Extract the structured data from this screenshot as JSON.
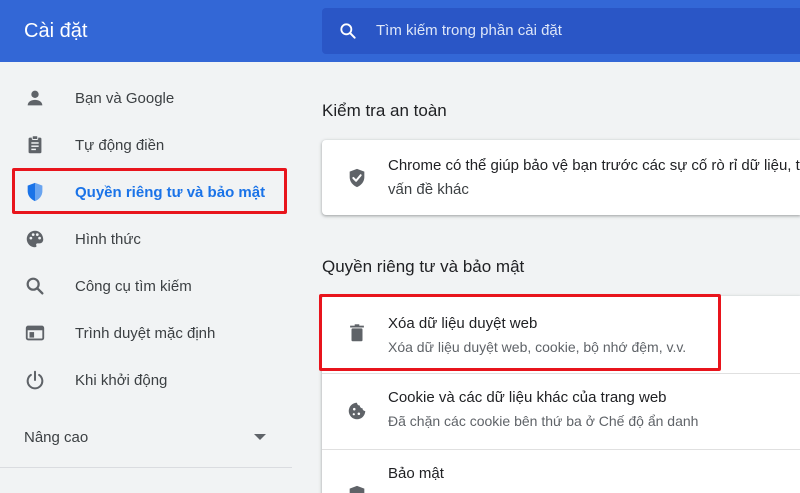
{
  "header": {
    "title": "Cài đặt",
    "search_placeholder": "Tìm kiếm trong phần cài đặt"
  },
  "sidebar": {
    "items": [
      {
        "label": "Bạn và Google",
        "icon": "person-icon"
      },
      {
        "label": "Tự động điền",
        "icon": "clipboard-icon"
      },
      {
        "label": "Quyền riêng tư và bảo mật",
        "icon": "shield-icon",
        "active": true
      },
      {
        "label": "Hình thức",
        "icon": "palette-icon"
      },
      {
        "label": "Công cụ tìm kiếm",
        "icon": "search-icon"
      },
      {
        "label": "Trình duyệt mặc định",
        "icon": "browser-window-icon"
      },
      {
        "label": "Khi khởi động",
        "icon": "power-icon"
      }
    ],
    "advanced_label": "Nâng cao"
  },
  "main": {
    "safety_check": {
      "title": "Kiểm tra an toàn",
      "description_line1": "Chrome có thể giúp bảo vệ bạn trước các sự cố rò rỉ dữ liệu, t",
      "description_line2": "vấn đề khác"
    },
    "privacy": {
      "title": "Quyền riêng tư và bảo mật",
      "rows": [
        {
          "title": "Xóa dữ liệu duyệt web",
          "subtitle": "Xóa dữ liệu duyệt web, cookie, bộ nhớ đệm, v.v.",
          "icon": "trash-icon"
        },
        {
          "title": "Cookie và các dữ liệu khác của trang web",
          "subtitle": "Đã chặn các cookie bên thứ ba ở Chế độ ẩn danh",
          "icon": "cookie-icon"
        },
        {
          "title": "Bảo mật",
          "subtitle": "",
          "icon": "shield-icon"
        }
      ]
    }
  },
  "colors": {
    "header_bg": "#3367d6",
    "accent": "#1a73e8",
    "highlight": "#e8141c"
  }
}
